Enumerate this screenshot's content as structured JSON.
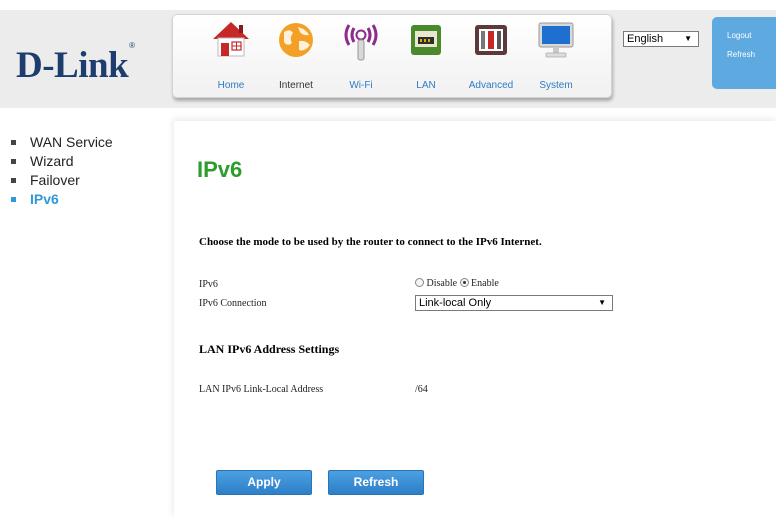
{
  "brand": {
    "logo_text": "D-Link",
    "registered_mark": "®"
  },
  "nav": {
    "items": [
      {
        "label": "Home",
        "icon": "home-icon"
      },
      {
        "label": "Internet",
        "icon": "globe-icon"
      },
      {
        "label": "Wi-Fi",
        "icon": "wifi-icon"
      },
      {
        "label": "LAN",
        "icon": "lan-icon"
      },
      {
        "label": "Advanced",
        "icon": "advanced-icon"
      },
      {
        "label": "System",
        "icon": "monitor-icon"
      }
    ],
    "active": "Internet"
  },
  "language": {
    "selected": "English"
  },
  "user_menu": {
    "logout": "Logout",
    "refresh": "Refresh"
  },
  "sidebar": {
    "items": [
      {
        "label": "WAN Service"
      },
      {
        "label": "Wizard"
      },
      {
        "label": "Failover"
      },
      {
        "label": "IPv6"
      }
    ],
    "active": "IPv6"
  },
  "page": {
    "title": "IPv6",
    "instructions": "Choose the mode to be used by the router to connect to the IPv6 Internet.",
    "ipv6_label": "IPv6",
    "radio_disable": "Disable",
    "radio_enable": "Enable",
    "radio_selected": "Enable",
    "connection_label": "IPv6 Connection",
    "connection_value": "Link-local Only",
    "lan_section_title": "LAN IPv6 Address Settings",
    "lan_link_local_label": "LAN IPv6 Link-Local Address",
    "lan_link_local_value": "/64"
  },
  "buttons": {
    "apply": "Apply",
    "refresh": "Refresh"
  },
  "colors": {
    "accent_blue": "#3199d9",
    "title_green": "#2e9c2e",
    "logo_navy": "#1c3d6e",
    "button_blue": "#2d80c8"
  }
}
